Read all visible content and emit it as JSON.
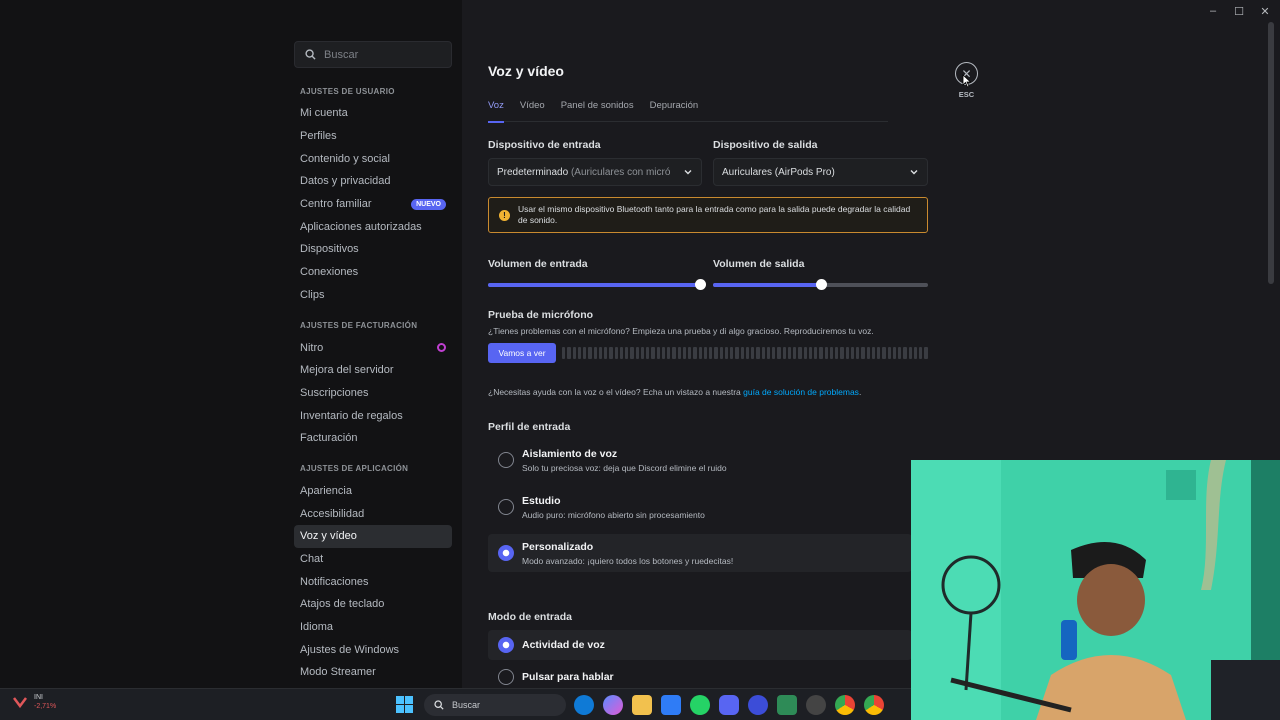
{
  "window_controls": {
    "minimize": "–",
    "maximize": "☐",
    "close": "✕"
  },
  "search": {
    "placeholder": "Buscar"
  },
  "sidebar": {
    "user_section": "AJUSTES DE USUARIO",
    "user_items": [
      "Mi cuenta",
      "Perfiles",
      "Contenido y social",
      "Datos y privacidad",
      "Centro familiar",
      "Aplicaciones autorizadas",
      "Dispositivos",
      "Conexiones",
      "Clips"
    ],
    "new_badge": "NUEVO",
    "billing_section": "AJUSTES DE FACTURACIÓN",
    "billing_items": [
      "Nitro",
      "Mejora del servidor",
      "Suscripciones",
      "Inventario de regalos",
      "Facturación"
    ],
    "app_section": "AJUSTES DE APLICACIÓN",
    "app_items": [
      "Apariencia",
      "Accesibilidad",
      "Voz y vídeo",
      "Chat",
      "Notificaciones",
      "Atajos de teclado",
      "Idioma",
      "Ajustes de Windows",
      "Modo Streamer"
    ]
  },
  "page": {
    "title": "Voz y vídeo",
    "tabs": [
      "Voz",
      "Vídeo",
      "Panel de sonidos",
      "Depuración"
    ],
    "input_device_label": "Dispositivo de entrada",
    "input_device_value": "Predeterminado",
    "input_device_detail": "(Auriculares con micró",
    "output_device_label": "Dispositivo de salida",
    "output_device_value": "Auriculares (AirPods Pro)",
    "warning": "Usar el mismo dispositivo Bluetooth tanto para la entrada como para la salida puede degradar la calidad de sonido.",
    "input_volume_label": "Volumen de entrada",
    "output_volume_label": "Volumen de salida",
    "input_volume": 0.99,
    "output_volume": 0.5,
    "mic_test_title": "Prueba de micrófono",
    "mic_test_desc": "¿Tienes problemas con el micrófono? Empieza una prueba y di algo gracioso. Reproduciremos tu voz.",
    "mic_test_button": "Vamos a ver",
    "help_text": "¿Necesitas ayuda con la voz o el vídeo? Echa un vistazo a nuestra ",
    "help_link": "guía de solución de problemas",
    "help_end": ".",
    "input_profile_title": "Perfil de entrada",
    "profiles": [
      {
        "title": "Aislamiento de voz",
        "desc": "Solo tu preciosa voz: deja que Discord elimine el ruido"
      },
      {
        "title": "Estudio",
        "desc": "Audio puro: micrófono abierto sin procesamiento"
      },
      {
        "title": "Personalizado",
        "desc": "Modo avanzado: ¡quiero todos los botones y ruedecitas!"
      }
    ],
    "input_mode_title": "Modo de entrada",
    "modes": [
      "Actividad de voz",
      "Pulsar para hablar"
    ],
    "esc_label": "ESC"
  },
  "taskbar": {
    "stock_value": "INI",
    "stock_change": "-2,71%",
    "stock_badge": "2",
    "search_placeholder": "Buscar"
  },
  "colors": {
    "accent": "#5865f2",
    "warning": "#f0b232",
    "link": "#00a8fc",
    "webcam_bg": "#35c9a0"
  }
}
